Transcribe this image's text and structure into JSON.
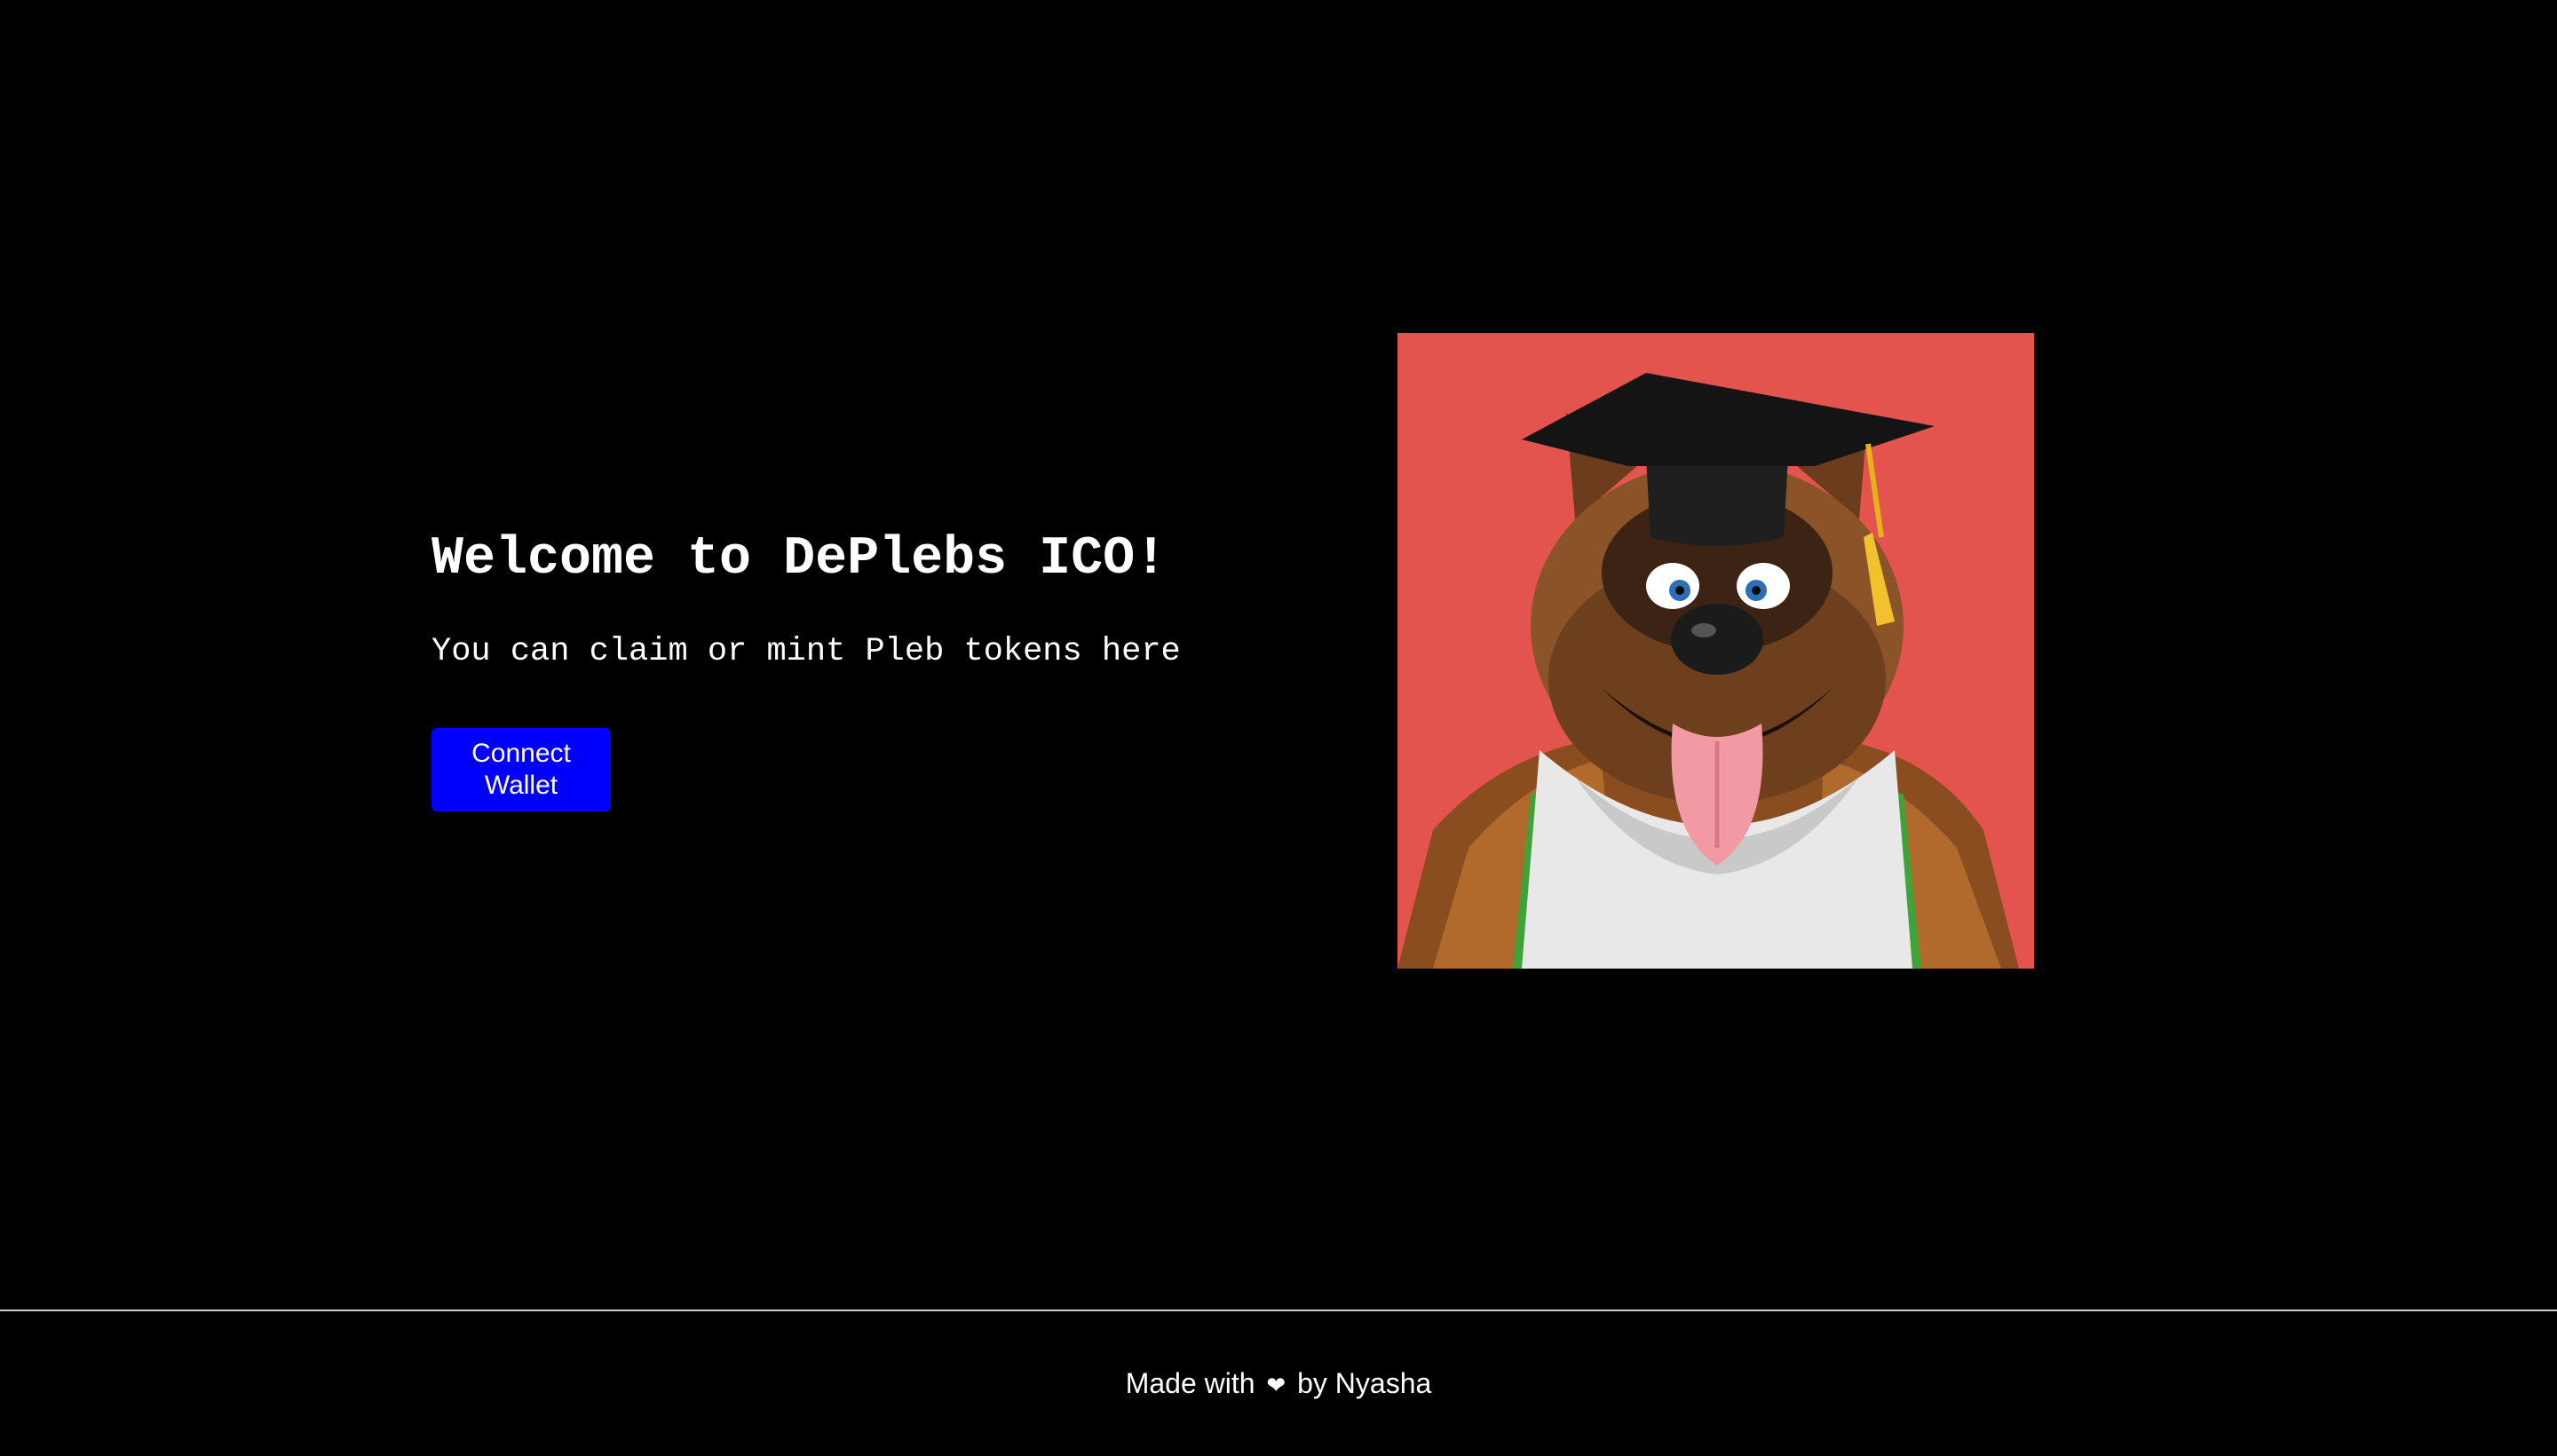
{
  "hero": {
    "title": "Welcome to DePlebs ICO!",
    "subtitle": "You can claim or mint Pleb tokens here",
    "connect_button_label": "Connect Wallet",
    "image": {
      "icon": "graduate-dog-illustration",
      "background_color": "#e4544e"
    }
  },
  "footer": {
    "prefix": "Made with",
    "heart_icon": "❤",
    "suffix": "by Nyasha"
  },
  "colors": {
    "background": "#000000",
    "text": "#ffffff",
    "button": "#0000ff",
    "image_background": "#e4544e",
    "divider": "#cfcfcf"
  }
}
